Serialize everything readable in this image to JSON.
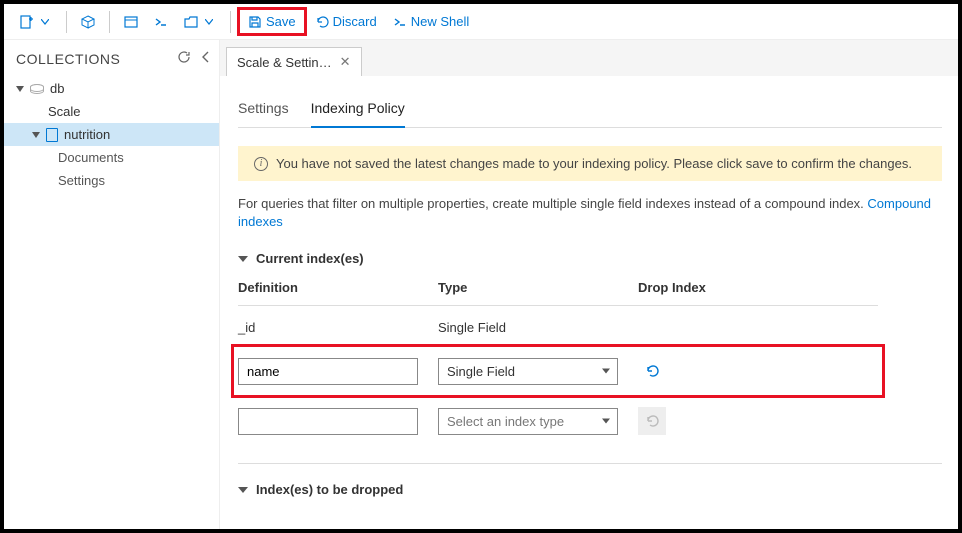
{
  "toolbar": {
    "save_label": "Save",
    "discard_label": "Discard",
    "newshell_label": "New Shell"
  },
  "sidebar": {
    "title": "COLLECTIONS",
    "db_label": "db",
    "scale_label": "Scale",
    "coll_label": "nutrition",
    "documents_label": "Documents",
    "settings_label": "Settings"
  },
  "main": {
    "tab_label": "Scale & Settin…",
    "subtabs": {
      "settings": "Settings",
      "indexing": "Indexing Policy"
    },
    "banner": "You have not saved the latest changes made to your indexing policy. Please click save to confirm the changes.",
    "desc_pre": "For queries that filter on multiple properties, create multiple single field indexes instead of a compound index. ",
    "desc_link": "Compound indexes",
    "section_current": "Current index(es)",
    "section_drop": "Index(es) to be dropped",
    "cols": {
      "def": "Definition",
      "type": "Type",
      "drop": "Drop Index"
    },
    "rows": [
      {
        "def": "_id",
        "type": "Single Field",
        "editable": false
      },
      {
        "def": "name",
        "type": "Single Field",
        "editable": true,
        "highlight": true
      },
      {
        "def": "",
        "type_placeholder": "Select an index type",
        "editable": true,
        "empty": true
      }
    ]
  }
}
